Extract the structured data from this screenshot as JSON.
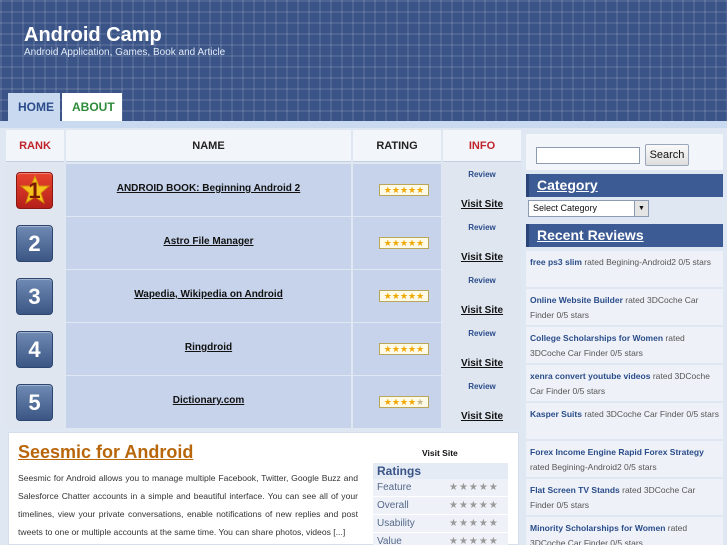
{
  "site": {
    "title": "Android Camp",
    "description": "Android Application, Games, Book and Article"
  },
  "nav": {
    "home": "HOME",
    "about": "ABOUT"
  },
  "table": {
    "headers": {
      "rank": "RANK",
      "name": "NAME",
      "rating": "RATING",
      "info": "INFO"
    },
    "rows": [
      {
        "rank": "1",
        "name": "ANDROID BOOK: Beginning Android 2",
        "rating": 5,
        "review": "Review",
        "visit": "Visit Site"
      },
      {
        "rank": "2",
        "name": "Astro File Manager",
        "rating": 5,
        "review": "Review",
        "visit": "Visit Site"
      },
      {
        "rank": "3",
        "name": "Wapedia, Wikipedia on Android",
        "rating": 5,
        "review": "Review",
        "visit": "Visit Site"
      },
      {
        "rank": "4",
        "name": "Ringdroid",
        "rating": 5,
        "review": "Review",
        "visit": "Visit Site"
      },
      {
        "rank": "5",
        "name": "Dictionary.com",
        "rating": 4.5,
        "review": "Review",
        "visit": "Visit Site"
      }
    ]
  },
  "post": {
    "title": "Seesmic for Android",
    "body": "Seesmic for Android allows you to manage multiple Facebook, Twitter, Google Buzz and Salesforce Chatter accounts in a simple and beautiful interface. You can see all of your timelines, view your private conversations, enable notifications of new replies and post tweets to one or multiple accounts at the same time. You can share photos, videos [...]",
    "visit": "Visit Site",
    "ratings_title": "Ratings",
    "ratings": [
      {
        "label": "Feature",
        "stars": "★★★★★"
      },
      {
        "label": "Overall",
        "stars": "★★★★★"
      },
      {
        "label": "Usability",
        "stars": "★★★★★"
      },
      {
        "label": "Value",
        "stars": "★★★★★"
      }
    ]
  },
  "sidebar": {
    "search_button": "Search",
    "search_value": "",
    "category_title": "Category",
    "category_selected": "Select Category",
    "recent_title": "Recent Reviews",
    "reviews": [
      {
        "title": "free ps3 slim",
        "text": " rated  Begining-Android2 0/5 stars"
      },
      {
        "title": "Online Website Builder",
        "text": " rated  3DCoche Car Finder 0/5 stars"
      },
      {
        "title": "College Scholarships for Women",
        "text": " rated  3DCoche Car Finder 0/5 stars"
      },
      {
        "title": "xenra convert youtube videos",
        "text": " rated  3DCoche Car Finder 0/5 stars"
      },
      {
        "title": "Kasper Suits",
        "text": " rated  3DCoche Car Finder 0/5 stars"
      },
      {
        "title": "Forex Income Engine Rapid Forex Strategy",
        "text": " rated  Begining-Android2 0/5 stars"
      },
      {
        "title": "Flat Screen TV Stands",
        "text": " rated  3DCoche Car Finder 0/5 stars"
      },
      {
        "title": "Minority Scholarships for Women",
        "text": " rated  3DCoche Car Finder 0/5 stars"
      }
    ]
  },
  "colors": {
    "header_bg": "#3a5488",
    "accent_red": "#c0242b",
    "post_title": "#b9660b",
    "link_blue": "#2a4c8a"
  }
}
